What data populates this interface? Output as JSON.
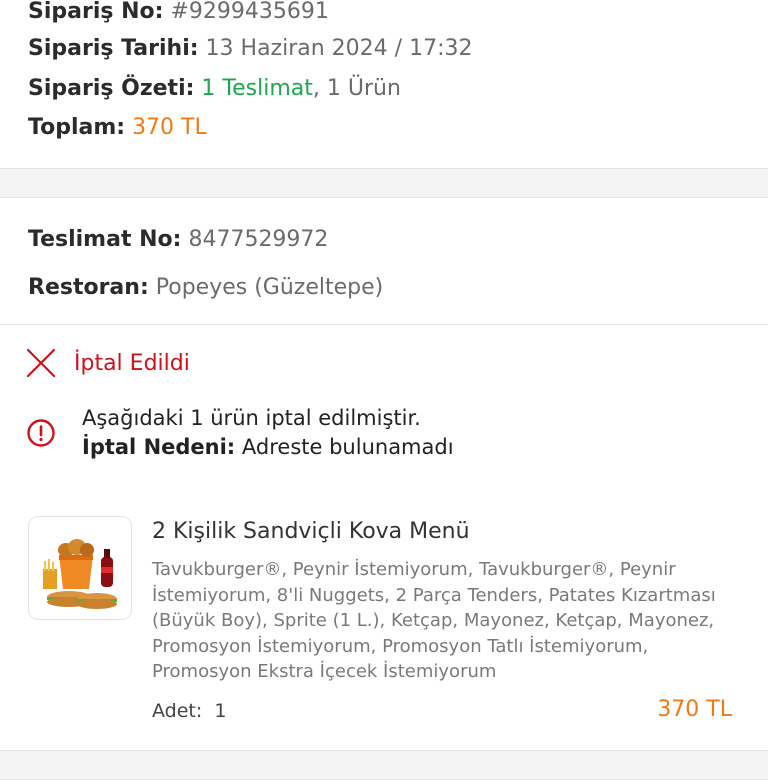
{
  "order": {
    "no_label": "Sipariş No:",
    "no_value": "#9299435691",
    "date_label": "Sipariş Tarihi:",
    "date_value": "13 Haziran 2024 / 17:32",
    "summary_label": "Sipariş Özeti:",
    "summary_delivery": "1 Teslimat",
    "summary_sep": ",",
    "summary_items": "1 Ürün",
    "total_label": "Toplam:",
    "total_value": "370 TL"
  },
  "delivery": {
    "no_label": "Teslimat No:",
    "no_value": "8477529972",
    "restaurant_label": "Restoran:",
    "restaurant_value": "Popeyes (Güzeltepe)"
  },
  "status": {
    "title": "İptal Edildi",
    "message_line1": "Aşağıdaki 1 ürün iptal edilmiştir.",
    "reason_label": "İptal Nedeni:",
    "reason_value": "Adreste bulunamadı"
  },
  "product": {
    "title": "2 Kişilik Sandviçli Kova Menü",
    "description": "Tavukburger®, Peynir İstemiyorum, Tavukburger®, Peynir İstemiyorum, 8'li Nuggets, 2 Parça Tenders, Patates Kızartması (Büyük Boy), Sprite (1 L.), Ketçap, Mayonez, Ketçap, Mayonez, Promosyon İstemiyorum, Promosyon Tatlı İstemiyorum, Promosyon Ekstra İçecek İstemiyorum",
    "qty_label": "Adet:",
    "qty_value": "1",
    "price": "370 TL"
  },
  "colors": {
    "green": "#1ea650",
    "orange": "#f07a14",
    "cancel_red": "#d0111b"
  }
}
